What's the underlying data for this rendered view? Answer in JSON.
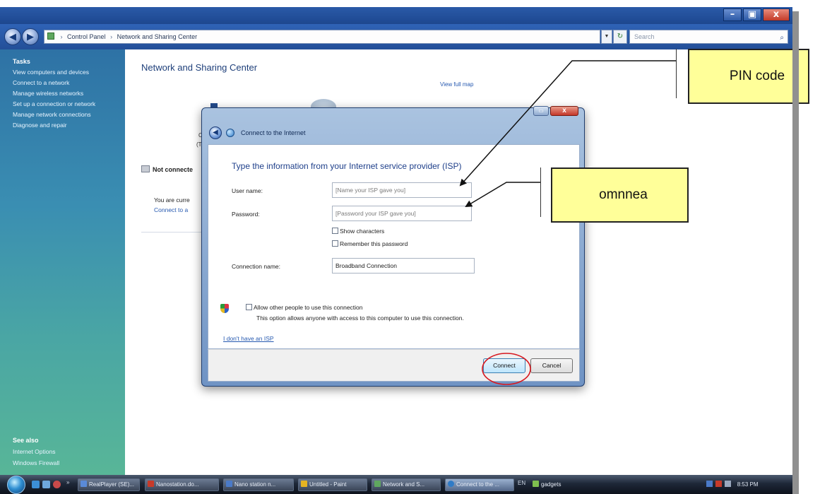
{
  "window": {
    "min_btn": "–",
    "max_btn": "▣",
    "close_btn": "x"
  },
  "address": {
    "crumbs": [
      "Control Panel",
      "Network and Sharing Center"
    ],
    "sep": "›",
    "search_placeholder": "Search"
  },
  "sidebar": {
    "tasks_heading": "Tasks",
    "tasks": [
      "View computers and devices",
      "Connect to a network",
      "Manage wireless networks",
      "Set up a connection or network",
      "Manage network connections",
      "Diagnose and repair"
    ],
    "see_also_heading": "See also",
    "see_also": [
      "Internet Options",
      "Windows Firewall"
    ]
  },
  "main": {
    "title": "Network and Sharing Center",
    "view_full_map": "View full map",
    "not_connected": "Not connecte",
    "you_are": "You are curre",
    "connect_to": "Connect to a",
    "ghost_c": "C",
    "ghost_t": "(T"
  },
  "dialog": {
    "title": "Connect to the Internet",
    "heading": "Type the information from your Internet service provider (ISP)",
    "username_label": "User name:",
    "username_placeholder": "[Name your ISP gave you]",
    "password_label": "Password:",
    "password_placeholder": "[Password your ISP gave you]",
    "show_chars": "Show characters",
    "remember_pw": "Remember this password",
    "conn_name_label": "Connection name:",
    "conn_name_value": "Broadband Connection",
    "allow_label": "Allow other people to use this connection",
    "allow_desc": "This option allows anyone with access to this computer to use this connection.",
    "no_isp": "I don't have an ISP",
    "connect_btn": "Connect",
    "cancel_btn": "Cancel",
    "close_x": "x"
  },
  "annotations": {
    "pin": "PIN code",
    "omn": "omnnea"
  },
  "taskbar": {
    "tasks": [
      "RealPlayer (SE)...",
      "Nanostation.do...",
      "Nano station n...",
      "Untitled - Paint",
      "Network and S...",
      "Connect to the ...",
      "gadgets"
    ],
    "lang": "EN",
    "clock": "8:53 PM"
  },
  "colors": {
    "accent": "#2659b0",
    "callout": "#ffff99",
    "highlight_ring": "#d71920"
  }
}
